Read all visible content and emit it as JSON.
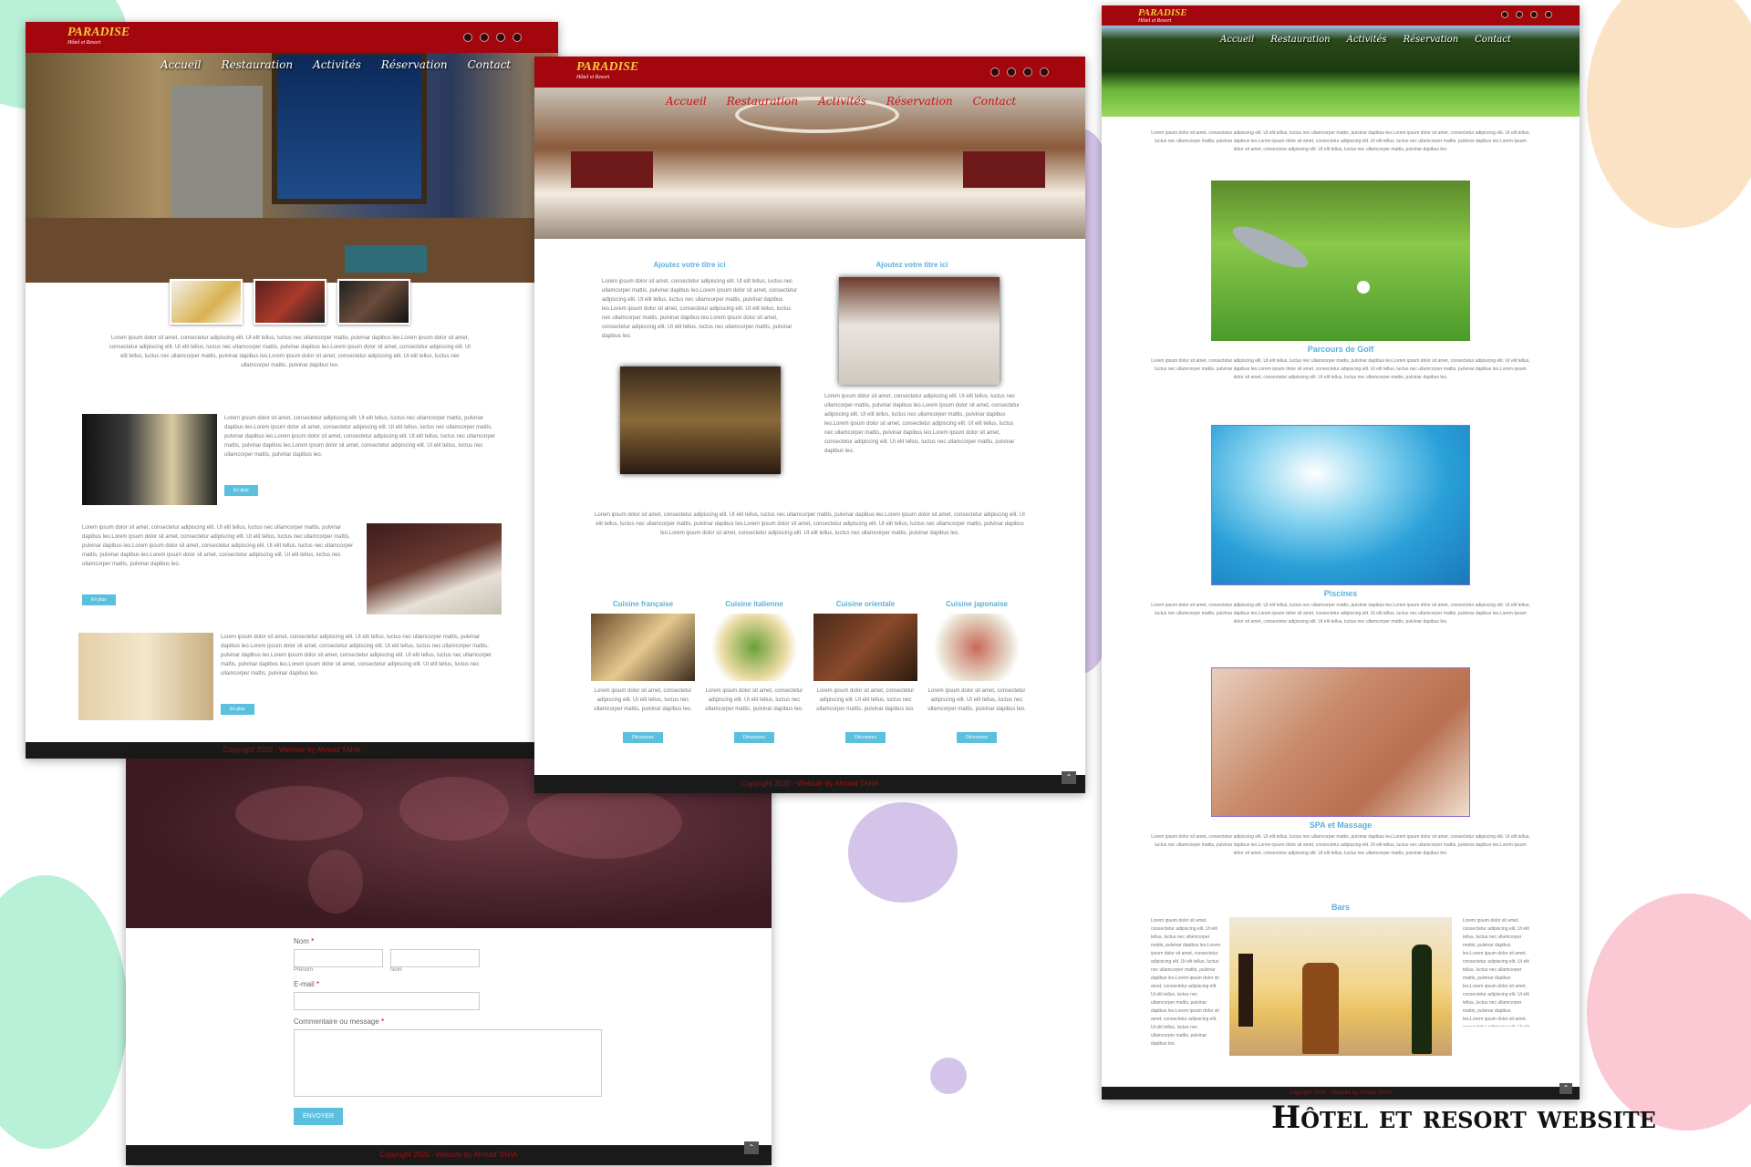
{
  "brand": {
    "logo": "PARADISE",
    "tagline": "Hôtel et Resort"
  },
  "nav": [
    "Accueil",
    "Restauration",
    "Activités",
    "Réservation",
    "Contact"
  ],
  "lorem_short": "Lorem ipsum dolor sit amet, consectetur adipiscing elit. Ut elit tellus, luctus nec ullamcorper mattis, pulvinar dapibus leo.",
  "lorem_long": "Lorem ipsum dolor sit amet, consectetur adipiscing elit. Ut elit tellus, luctus nec ullamcorper mattis, pulvinar dapibus leo.Lorem ipsum dolor sit amet, consectetur adipiscing elit. Ut elit tellus, luctus nec ullamcorper mattis, pulvinar dapibus leo.Lorem ipsum dolor sit amet, consectetur adipiscing elit. Ut elit tellus, luctus nec ullamcorper mattis, pulvinar dapibus leo.Lorem ipsum dolor sit amet, consectetur adipiscing elit. Ut elit tellus, luctus nec ullamcorper mattis, pulvinar dapibus leo.",
  "home": {
    "en_plus": "En plus"
  },
  "restaurant": {
    "section_title": "Ajoutez votre titre ici",
    "cuisines": [
      "Cuisine française",
      "Cuisine italienne",
      "Cuisine orientale",
      "Cuisine japonaise"
    ],
    "discover": "Découvrez"
  },
  "activities": {
    "items": [
      "Parcours de Golf",
      "Piscines",
      "SPA et Massage",
      "Bars"
    ]
  },
  "contact": {
    "name_label": "Nom",
    "required": "*",
    "first_sub": "Prénom",
    "last_sub": "Nom",
    "email_label": "E-mail",
    "message_label": "Commentaire ou message",
    "submit": "ENVOYER"
  },
  "footer": "Copyright 2020 - Website by Ahmad TAHA",
  "caption": "Hôtel et resort website"
}
